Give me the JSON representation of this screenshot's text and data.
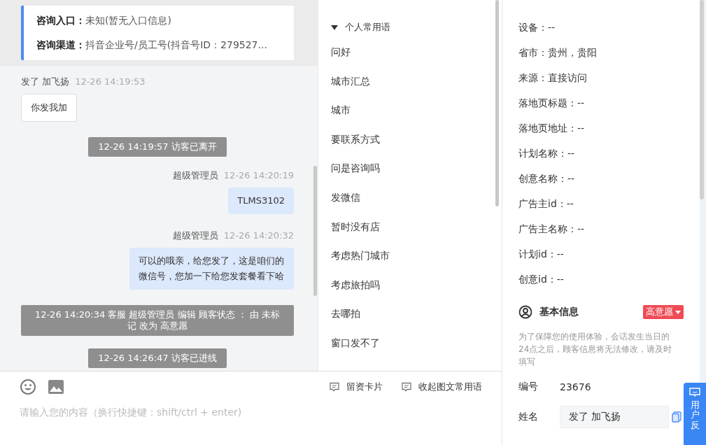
{
  "info_card": {
    "rows": [
      {
        "label": "咨询入口：",
        "value": "未知(暂无入口信息)"
      },
      {
        "label": "咨询渠道：",
        "value": "抖音企业号/员工号(抖音号ID：279527..."
      }
    ]
  },
  "messages": [
    {
      "kind": "visitor",
      "sender": "发了 加飞扬",
      "time": "12-26 14:19:53",
      "text": "你发我加"
    },
    {
      "kind": "system",
      "text": "12-26 14:19:57 访客已离开"
    },
    {
      "kind": "agent",
      "sender": "超级管理员",
      "time": "12-26 14:20:19",
      "text": "TLMS3102"
    },
    {
      "kind": "agent",
      "sender": "超级管理员",
      "time": "12-26 14:20:32",
      "text": "可以的哦亲，给您发了，这是咱们的微信号，您加一下给您发套餐看下哈"
    },
    {
      "kind": "system",
      "text": "12-26 14:20:34 客服 超级管理员 编辑 顾客状态 ： 由 未标记 改为 高意愿"
    },
    {
      "kind": "system",
      "text": "12-26 14:26:47 访客已进线"
    }
  ],
  "composer": {
    "actions": [
      "留资卡片",
      "收起图文常用语"
    ],
    "placeholder": "请输入您的内容（换行快捷键：shift/ctrl + enter)"
  },
  "phrases": {
    "group": "个人常用语",
    "expanded": true,
    "items": [
      "问好",
      "城市汇总",
      "城市",
      "要联系方式",
      "问是咨询吗",
      "发微信",
      "暂时没有店",
      "考虑热门城市",
      "考虑旅拍吗",
      "去哪拍",
      "窗口发不了"
    ]
  },
  "source_info": [
    "设备：--",
    "省市：贵州，贵阳",
    "来源：直接访问",
    "落地页标题：--",
    "落地页地址：--",
    "计划名称：--",
    "创意名称：--",
    "广告主id：--",
    "广告主名称：--",
    "计划id：--",
    "创意id：--"
  ],
  "basic_info": {
    "title": "基本信息",
    "status_tag": "高意愿",
    "note": "为了保障您的使用体验，会话发生当日的24点之后，顾客信息将无法修改，请及时填写",
    "fields": [
      {
        "kind": "text",
        "label": "编号",
        "value": "23676"
      },
      {
        "kind": "input",
        "label": "姓名",
        "value": "发了 加飞扬"
      }
    ]
  },
  "feedback_tab": "用户反"
}
